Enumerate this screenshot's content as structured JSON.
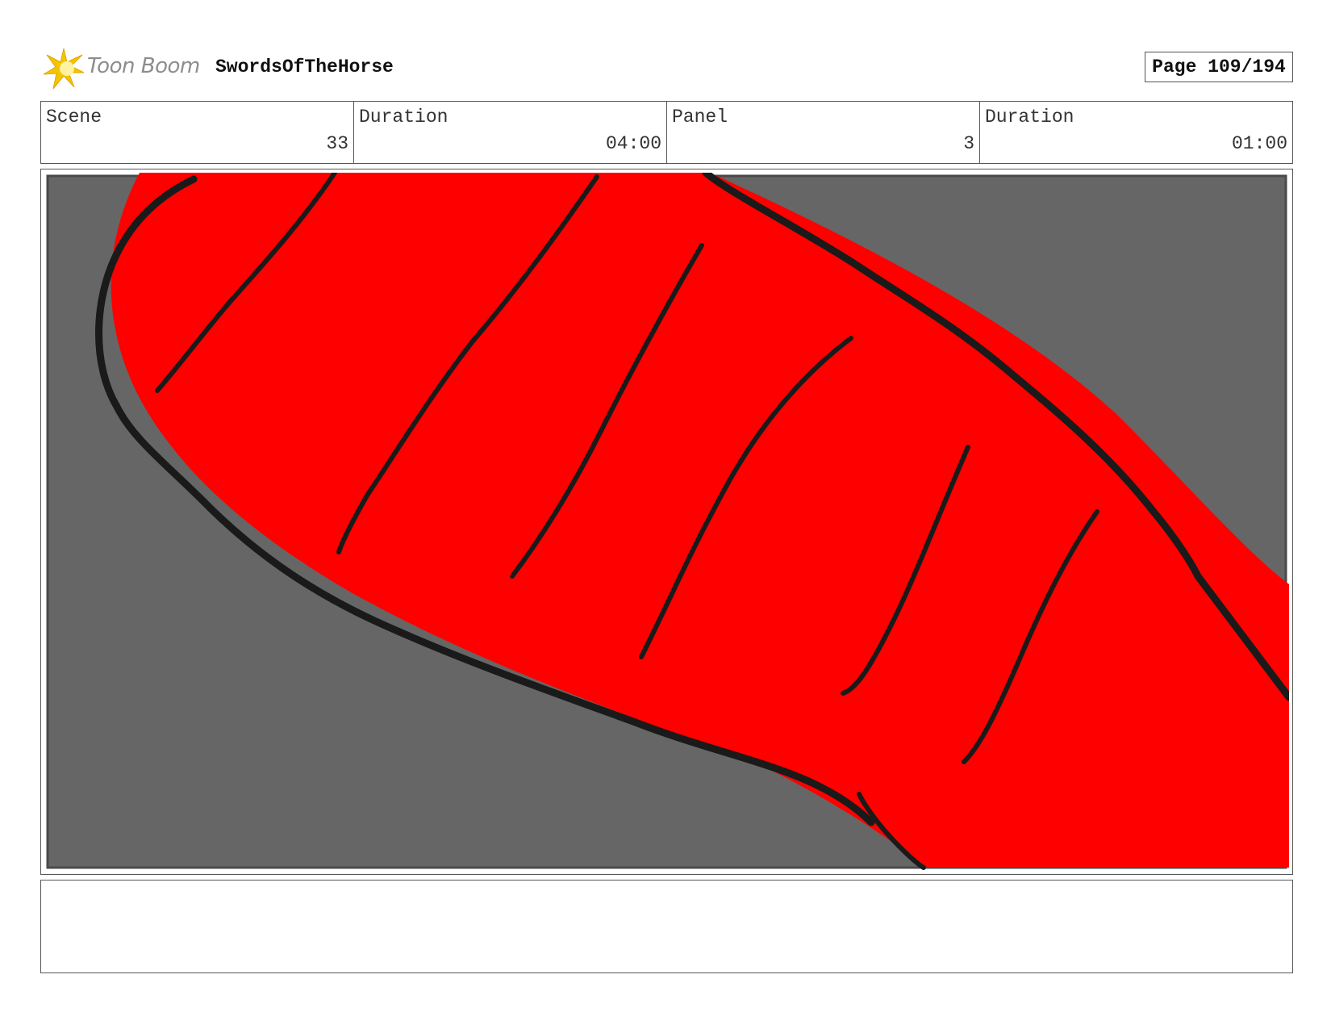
{
  "header": {
    "logo_text": "Toon Boom",
    "project_title": "SwordsOfTheHorse",
    "page_label": "Page 109/194"
  },
  "info": {
    "scene_label": "Scene",
    "scene_value": "33",
    "scene_duration_label": "Duration",
    "scene_duration_value": "04:00",
    "panel_label": "Panel",
    "panel_value": "3",
    "panel_duration_label": "Duration",
    "panel_duration_value": "01:00"
  },
  "notes": {
    "text": ""
  },
  "colors": {
    "logo_star": "#f5c400",
    "background": "#666666",
    "shape_fill": "#ff0000",
    "ink": "#1a1a1a"
  }
}
